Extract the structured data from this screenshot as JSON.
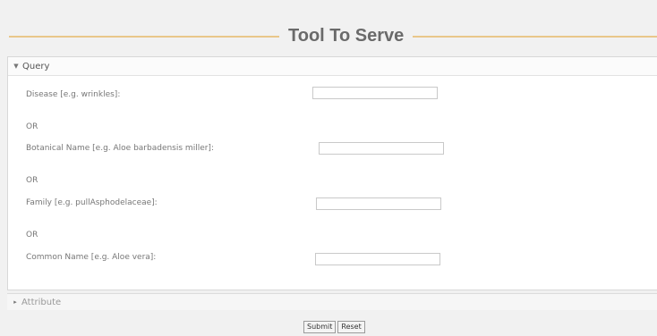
{
  "header": {
    "title": "Tool To Serve"
  },
  "query_section": {
    "label": "Query",
    "disease_label": "Disease [e.g. wrinkles]:",
    "or_1": "OR",
    "botanical_label": "Botanical Name [e.g. Aloe barbadensis miller]:",
    "or_2": "OR",
    "family_label": "Family [e.g. pullAsphodelaceae]:",
    "or_3": "OR",
    "common_label": "Common Name [e.g. Aloe vera]:"
  },
  "attribute_section": {
    "label": "Attribute"
  },
  "buttons": {
    "submit": "Submit",
    "reset": "Reset"
  },
  "icons": {
    "query_caret": "caret-down-icon",
    "attribute_caret": "caret-right-icon"
  }
}
